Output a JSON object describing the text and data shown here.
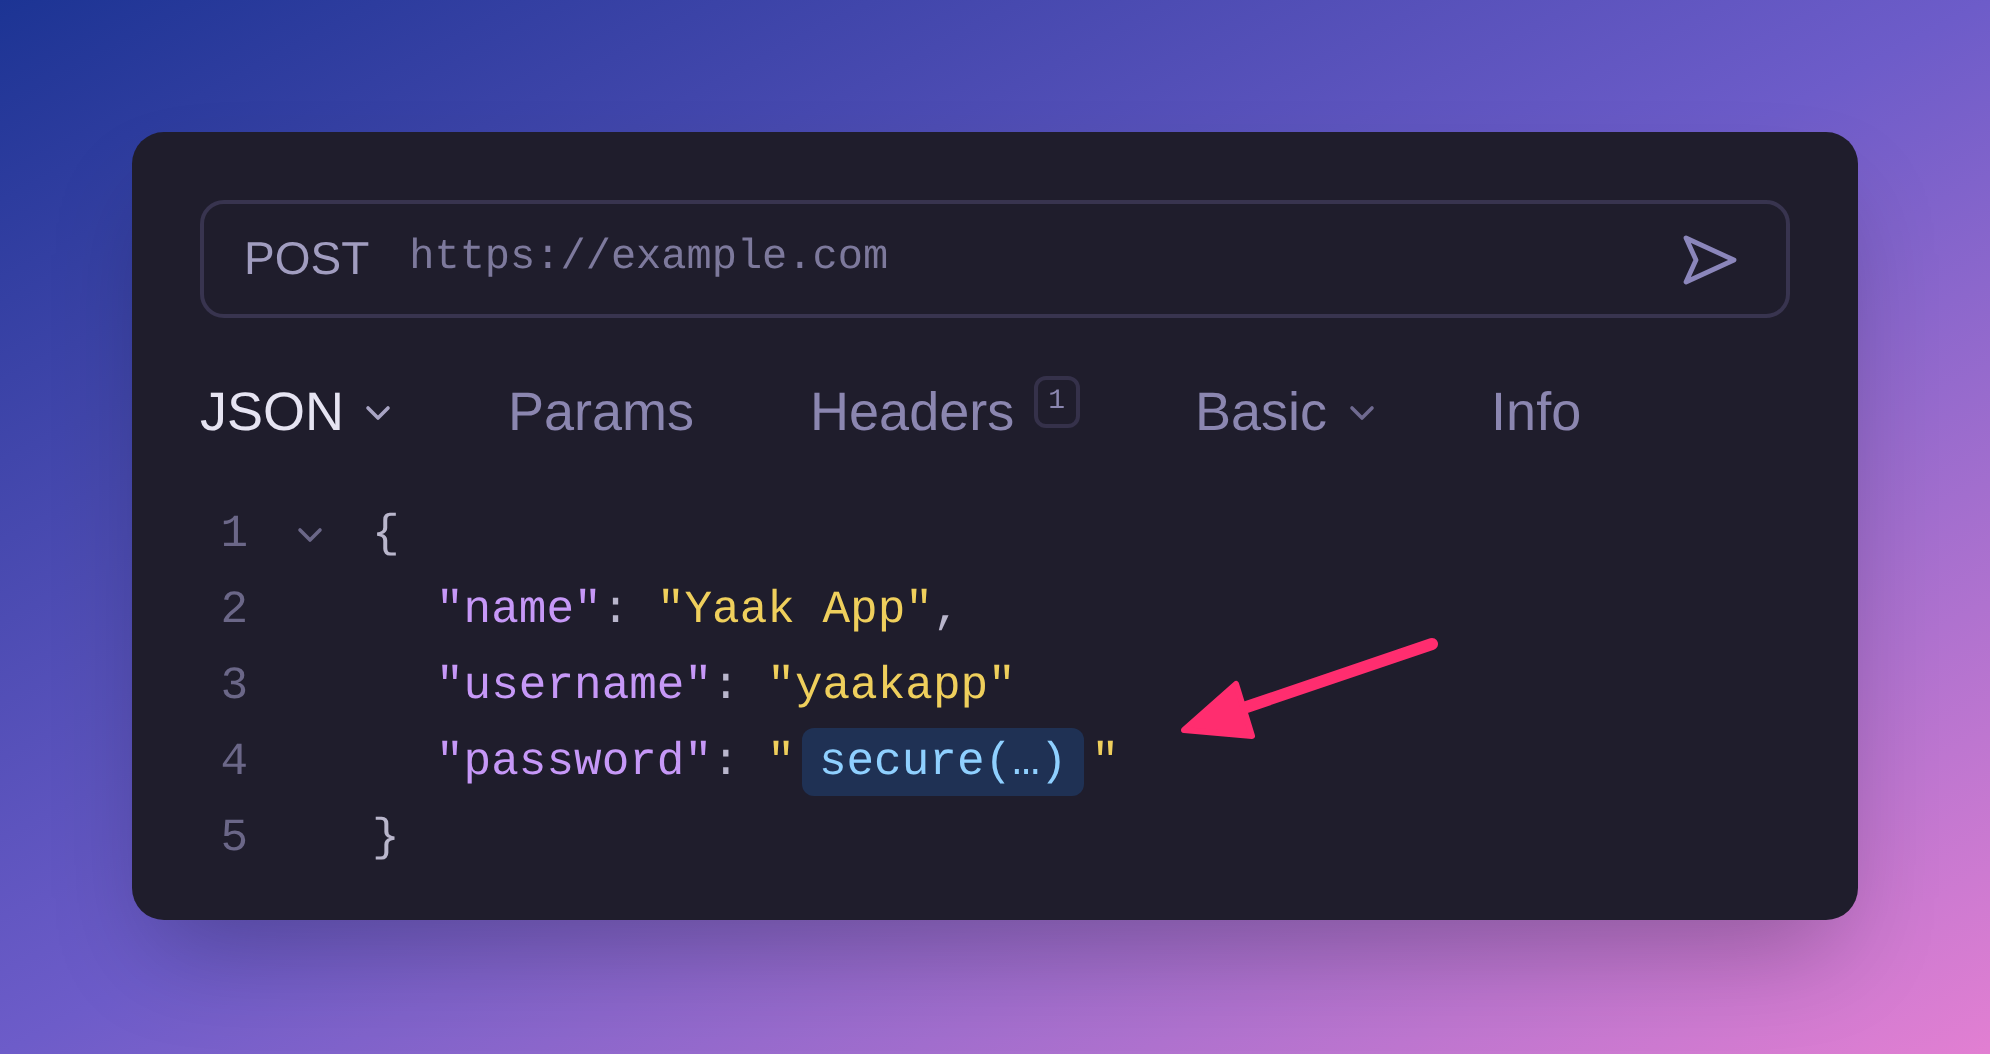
{
  "request": {
    "method": "POST",
    "url": "https://example.com"
  },
  "tabs": [
    {
      "label": "JSON",
      "selected": true,
      "dropdown": true
    },
    {
      "label": "Params",
      "selected": false,
      "dropdown": false
    },
    {
      "label": "Headers",
      "selected": false,
      "dropdown": false,
      "badge": "1"
    },
    {
      "label": "Basic",
      "selected": false,
      "dropdown": true
    },
    {
      "label": "Info",
      "selected": false,
      "dropdown": false
    }
  ],
  "code": {
    "lines": [
      {
        "number": "1",
        "kind": "brace",
        "expanded": true,
        "tokens": [
          {
            "kind": "punct",
            "text": "{"
          }
        ]
      },
      {
        "number": "2",
        "kind": "member",
        "tokens": [
          {
            "kind": "key",
            "text": "\"name\""
          },
          {
            "kind": "punct",
            "text": ": "
          },
          {
            "kind": "string",
            "text": "\"Yaak App\""
          },
          {
            "kind": "punct",
            "text": ","
          }
        ]
      },
      {
        "number": "3",
        "kind": "member",
        "tokens": [
          {
            "kind": "key",
            "text": "\"username\""
          },
          {
            "kind": "punct",
            "text": ": "
          },
          {
            "kind": "string",
            "text": "\"yaakapp\""
          }
        ]
      },
      {
        "number": "4",
        "kind": "member",
        "tokens": [
          {
            "kind": "key",
            "text": "\"password\""
          },
          {
            "kind": "punct",
            "text": ": "
          },
          {
            "kind": "string",
            "text": "\""
          },
          {
            "kind": "function",
            "text": "secure(…)"
          },
          {
            "kind": "string",
            "text": "\""
          }
        ]
      },
      {
        "number": "5",
        "kind": "brace",
        "tokens": [
          {
            "kind": "punct",
            "text": "}"
          }
        ]
      }
    ]
  }
}
